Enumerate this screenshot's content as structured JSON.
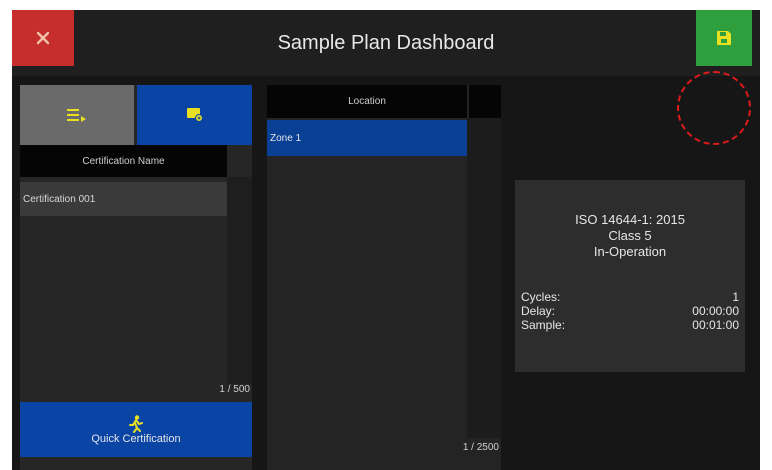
{
  "header": {
    "title": "Sample Plan Dashboard",
    "close_icon": "close-x-icon",
    "save_icon": "save-floppy-icon"
  },
  "certifications": {
    "list_icon": "list-icon",
    "add_icon": "add-certificate-icon",
    "column_header": "Certification Name",
    "items": [
      "Certification 001"
    ],
    "count": "1 / 500",
    "quick_label": "Quick Certification",
    "quick_icon": "running-person-icon"
  },
  "locations": {
    "column_header": "Location",
    "items": [
      "Zone 1"
    ],
    "count": "1 / 2500"
  },
  "standard": {
    "name": "ISO 14644-1: 2015",
    "class": "Class 5",
    "state": "In-Operation",
    "cycles_label": "Cycles:",
    "cycles_value": "1",
    "delay_label": "Delay:",
    "delay_value": "00:00:00",
    "sample_label": "Sample:",
    "sample_value": "00:01:00"
  },
  "colors": {
    "close": "#c62e2e",
    "save": "#2f9e3c",
    "accent_blue": "#0a45a6",
    "icon_yellow": "#e8e020",
    "annotation": "#e01b1b"
  }
}
